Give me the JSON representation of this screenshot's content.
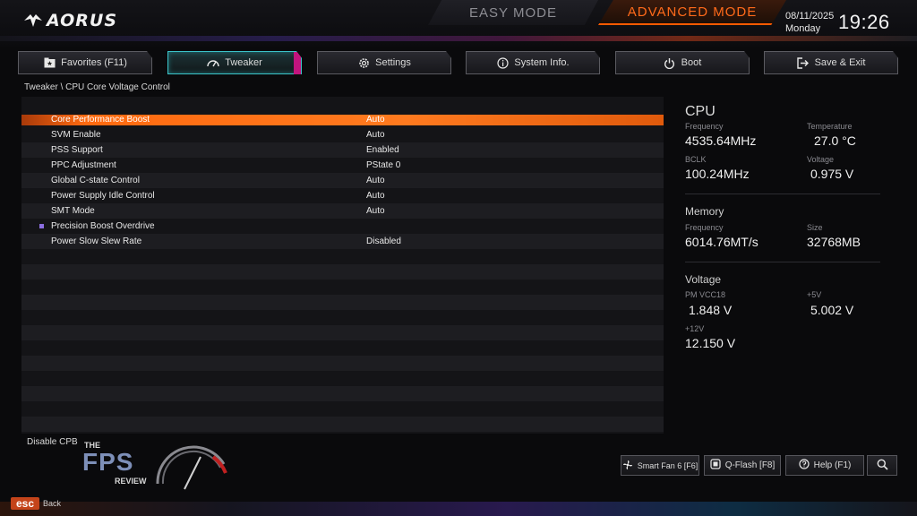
{
  "header": {
    "logo": "AORUS",
    "mode_easy": "EASY MODE",
    "mode_advanced": "ADVANCED MODE",
    "date": "08/11/2025",
    "day": "Monday",
    "time": "19:26"
  },
  "tabs": [
    {
      "label": "Favorites (F11)",
      "icon": "star-folder-icon"
    },
    {
      "label": "Tweaker",
      "icon": "gauge-icon",
      "active": true
    },
    {
      "label": "Settings",
      "icon": "gear-icon"
    },
    {
      "label": "System Info.",
      "icon": "info-icon"
    },
    {
      "label": "Boot",
      "icon": "power-icon"
    },
    {
      "label": "Save & Exit",
      "icon": "exit-icon"
    }
  ],
  "breadcrumb": "Tweaker \\ CPU Core Voltage Control",
  "settings": [
    {
      "name": "Core Performance Boost",
      "value": "Auto",
      "selected": true
    },
    {
      "name": "SVM Enable",
      "value": "Auto"
    },
    {
      "name": "PSS Support",
      "value": "Enabled"
    },
    {
      "name": "PPC Adjustment",
      "value": "PState 0"
    },
    {
      "name": "Global C-state Control",
      "value": "Auto"
    },
    {
      "name": "Power Supply Idle Control",
      "value": "Auto"
    },
    {
      "name": "SMT Mode",
      "value": "Auto"
    },
    {
      "name": "Precision Boost Overdrive",
      "value": "",
      "submenu": true
    },
    {
      "name": "Power Slow Slew Rate",
      "value": "Disabled"
    }
  ],
  "cpu": {
    "title": "CPU",
    "frequency_label": "Frequency",
    "frequency": "4535.64MHz",
    "temperature_label": "Temperature",
    "temperature": "27.0 °C",
    "bclk_label": "BCLK",
    "bclk": "100.24MHz",
    "voltage_label": "Voltage",
    "voltage": "0.975 V"
  },
  "memory": {
    "title": "Memory",
    "frequency_label": "Frequency",
    "frequency": "6014.76MT/s",
    "size_label": "Size",
    "size": "32768MB"
  },
  "voltage": {
    "title": "Voltage",
    "pm_label": "PM VCC18",
    "pm": "1.848 V",
    "v5_label": "+5V",
    "v5": "5.002 V",
    "v12_label": "+12V",
    "v12": "12.150 V"
  },
  "help_text": "Disable CPB",
  "watermark": {
    "the": "THE",
    "fps": "FPS",
    "review": "REVIEW"
  },
  "bottom_buttons": {
    "smart_fan": "Smart Fan 6 [F6]",
    "qflash": "Q-Flash [F8]",
    "help": "Help (F1)"
  },
  "esc": {
    "key": "esc",
    "label": "Back"
  },
  "colors": {
    "accent": "#ff6a10",
    "active_tab": "#3bc3c8",
    "bg": "#0a0a0c"
  }
}
